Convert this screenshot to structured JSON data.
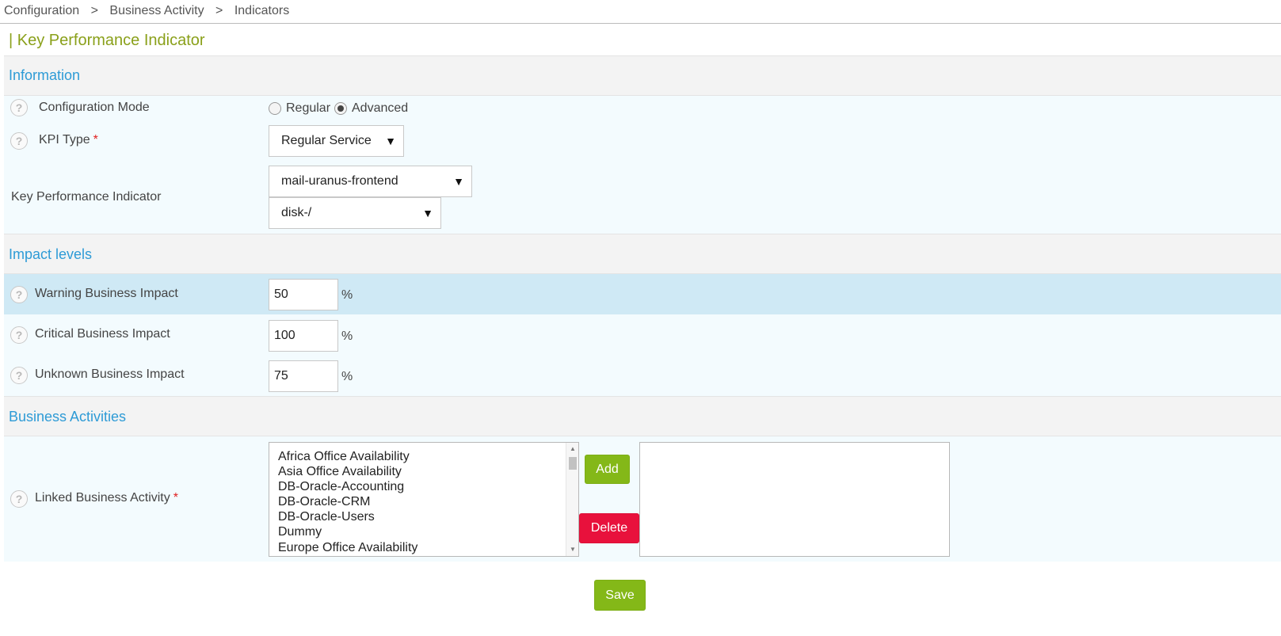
{
  "breadcrumb": {
    "items": [
      "Configuration",
      "Business Activity",
      "Indicators"
    ],
    "separator": ">"
  },
  "page": {
    "title": "| Key Performance Indicator"
  },
  "sections": {
    "information": "Information",
    "impact_levels": "Impact levels",
    "business_activities": "Business Activities"
  },
  "form": {
    "help_glyph": "?",
    "required_mark": "*",
    "configuration_mode": {
      "label": "Configuration Mode",
      "options": [
        "Regular",
        "Advanced"
      ],
      "selected": "Advanced"
    },
    "kpi_type": {
      "label": "KPI Type",
      "value": "Regular Service"
    },
    "kpi": {
      "label": "Key Performance Indicator",
      "host_value": "mail-uranus-frontend",
      "service_value": "disk-/"
    },
    "warning": {
      "label": "Warning Business Impact",
      "value": "50",
      "unit": "%"
    },
    "critical": {
      "label": "Critical Business Impact",
      "value": "100",
      "unit": "%"
    },
    "unknown": {
      "label": "Unknown Business Impact",
      "value": "75",
      "unit": "%"
    },
    "linked_ba": {
      "label": "Linked Business Activity",
      "available": [
        "Africa Office Availability",
        "Asia Office Availability",
        "DB-Oracle-Accounting",
        "DB-Oracle-CRM",
        "DB-Oracle-Users",
        "Dummy",
        "Europe Office Availability"
      ],
      "selected": [],
      "add_label": "Add",
      "delete_label": "Delete"
    }
  },
  "actions": {
    "save_label": "Save"
  },
  "colors": {
    "title_green": "#8aa01a",
    "section_blue": "#2e9bd6",
    "button_green": "#84b818",
    "button_red": "#e8113c",
    "row_highlight": "#cfe9f5"
  }
}
